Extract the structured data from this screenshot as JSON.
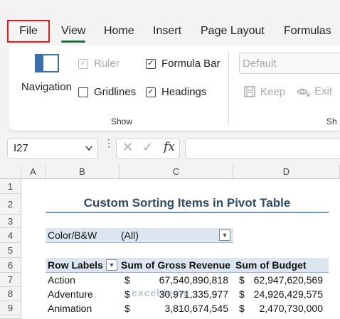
{
  "ribbon_tabs": {
    "file": "File",
    "view": "View",
    "home": "Home",
    "insert": "Insert",
    "page_layout": "Page Layout",
    "formulas": "Formulas"
  },
  "view_ribbon": {
    "navigation_label": "Navigation",
    "ruler_label": "Ruler",
    "ruler_checked": true,
    "ruler_enabled": false,
    "formula_bar_label": "Formula Bar",
    "formula_bar_checked": true,
    "gridlines_label": "Gridlines",
    "gridlines_checked": false,
    "headings_label": "Headings",
    "headings_checked": true,
    "show_group_label": "Show",
    "sheet_view_value": "Default",
    "keep_label": "Keep",
    "exit_label": "Exit",
    "next_group_label_partial": "Sh"
  },
  "formula_bar": {
    "name_box_value": "I27",
    "fx_label": "fx",
    "formula_value": ""
  },
  "grid": {
    "columns": [
      "A",
      "B",
      "C",
      "D"
    ],
    "rows": [
      "1",
      "2",
      "3",
      "4",
      "5",
      "6",
      "7",
      "8",
      "9"
    ]
  },
  "pivot": {
    "title": "Custom Sorting Items in Pivot Table",
    "filter_field": "Color/B&W",
    "filter_value": "(All)",
    "header_row_labels": "Row Labels",
    "header_gross": "Sum of Gross Revenue",
    "header_budget": "Sum of Budget",
    "rows": [
      {
        "label": "Action",
        "gross": "67,540,890,818",
        "budget": "62,947,620,569"
      },
      {
        "label": "Adventure",
        "gross": "30,971,335,977",
        "budget": "24,926,429,575"
      },
      {
        "label": "Animation",
        "gross": "3,810,674,545",
        "budget": "2,470,730,000"
      }
    ],
    "currency_symbol": "$"
  },
  "watermark": "exceldemy",
  "colors": {
    "accent_green": "#1e7145",
    "file_highlight": "#e02020",
    "pivot_header_fill": "#dce6f1",
    "title_color": "#2e4b6e"
  }
}
